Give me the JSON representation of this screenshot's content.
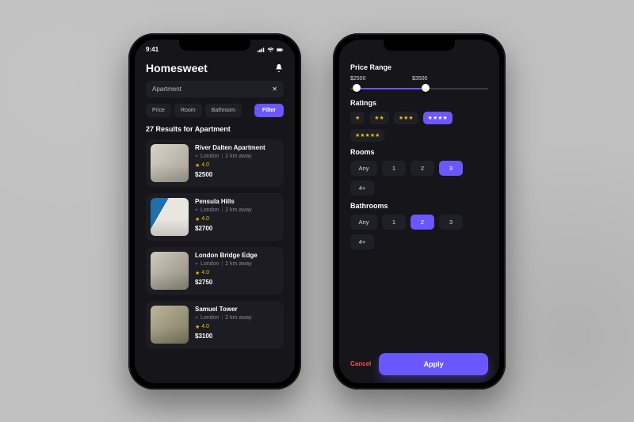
{
  "status_time": "9:41",
  "app_title": "Homesweet",
  "search": {
    "value": "Apartment"
  },
  "chips": {
    "price": "Price",
    "room": "Room",
    "bathroom": "Bathroom",
    "filter": "Filter"
  },
  "results_count_prefix": "27 Results for ",
  "results_count_term": "Apartment",
  "listings": [
    {
      "title": "River Dalten Apartment",
      "location": "London",
      "distance": "2 km away",
      "rating": "4.0",
      "price": "$2500"
    },
    {
      "title": "Pensula Hills",
      "location": "London",
      "distance": "2 km away",
      "rating": "4.0",
      "price": "$2700"
    },
    {
      "title": "London Bridge Edge",
      "location": "London",
      "distance": "2 km away",
      "rating": "4.0",
      "price": "$2750"
    },
    {
      "title": "Samuel Tower",
      "location": "London",
      "distance": "2 km away",
      "rating": "4.0",
      "price": "$3100"
    }
  ],
  "filters": {
    "price_label": "Price Range",
    "price_min": "$2500",
    "price_max": "$3500",
    "ratings_label": "Ratings",
    "ratings_selected": 4,
    "rooms_label": "Rooms",
    "rooms_options": [
      "Any",
      "1",
      "2",
      "3",
      "4+"
    ],
    "rooms_selected": "3",
    "bathrooms_label": "Bathrooms",
    "bathrooms_options": [
      "Any",
      "1",
      "2",
      "3",
      "4+"
    ],
    "bathrooms_selected": "2",
    "cancel": "Cancel",
    "apply": "Apply"
  },
  "colors": {
    "accent": "#6b57ff",
    "star": "#f2b90c",
    "danger": "#ff4d4d"
  }
}
